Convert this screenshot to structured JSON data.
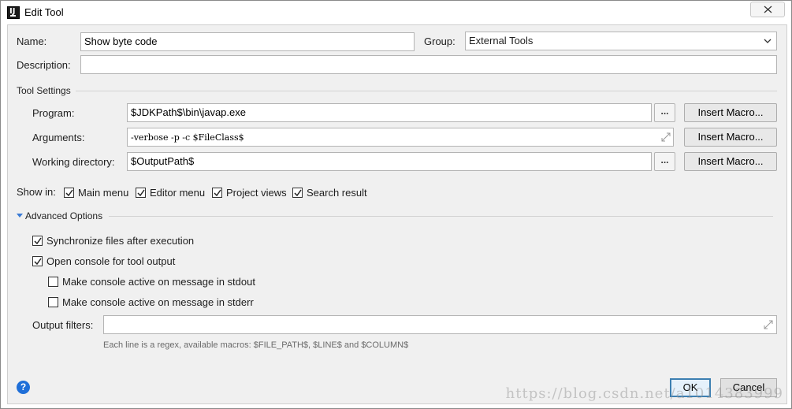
{
  "window": {
    "title": "Edit Tool",
    "app_icon_label": "IJ"
  },
  "form": {
    "name_label": "Name:",
    "name_value": "Show byte code",
    "group_label": "Group:",
    "group_value": "External Tools",
    "description_label": "Description:",
    "description_value": ""
  },
  "tool_settings": {
    "title": "Tool Settings",
    "program_label": "Program:",
    "program_value": "$JDKPath$\\bin\\javap.exe",
    "arguments_label": "Arguments:",
    "arguments_value": "-verbose -p -c $FileClass$",
    "workdir_label": "Working directory:",
    "workdir_value": "$OutputPath$",
    "browse_label": "...",
    "insert_macro_label": "Insert Macro..."
  },
  "show_in": {
    "label": "Show in:",
    "options": [
      {
        "label": "Main menu",
        "checked": true
      },
      {
        "label": "Editor menu",
        "checked": true
      },
      {
        "label": "Project views",
        "checked": true
      },
      {
        "label": "Search result",
        "checked": true
      }
    ]
  },
  "advanced": {
    "title": "Advanced Options",
    "sync_files": {
      "label": "Synchronize files after execution",
      "checked": true
    },
    "open_console": {
      "label": "Open console for tool output",
      "checked": true
    },
    "active_stdout": {
      "label": "Make console active on message in stdout",
      "checked": false
    },
    "active_stderr": {
      "label": "Make console active on message in stderr",
      "checked": false
    },
    "output_filters_label": "Output filters:",
    "output_filters_value": "",
    "hint": "Each line is a regex, available macros: $FILE_PATH$, $LINE$ and $COLUMN$"
  },
  "footer": {
    "help_label": "?",
    "ok_label": "OK",
    "cancel_label": "Cancel"
  },
  "watermark": "https://blog.csdn.net/a1014383999",
  "colors": {
    "accent": "#1f6fd8",
    "primary_button_border": "#3c7fb1"
  }
}
